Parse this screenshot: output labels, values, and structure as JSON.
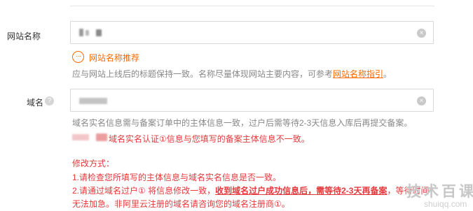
{
  "site_name": {
    "label": "网站名称",
    "recommend_text": "网站名称推荐",
    "hint_prefix": "应与网站上线后的标题保持一致。名称尽量体现网站主要内容，可参考",
    "hint_link": "网站名称指引",
    "hint_suffix": "。"
  },
  "domain": {
    "label": "域名",
    "hint": "域名实名信息需与备案订单中的主体信息一致，过户后需等待2-3天信息入库后再提交备案。",
    "error_text": "域名实名认证①信息与您填写的备案主体信息不一致。"
  },
  "fix": {
    "title": "修改方式：",
    "line1": "1.请检查您所填写的主体信息与域名实名信息是否一致。",
    "line2_a": "2.请通过域名过户① 将信息修改一致，",
    "line2_strong": "收到域名过户成功信息后，需等待2-3天再备案",
    "line2_b": "，等待时间",
    "line3": "无法加急。非阿里云注册的域名请咨询您的域名注册商①。"
  },
  "icons": {
    "clear": "×",
    "help": "?",
    "recommend": "···"
  },
  "watermark": {
    "title": "技术百课",
    "url": "shuiqq.com"
  }
}
